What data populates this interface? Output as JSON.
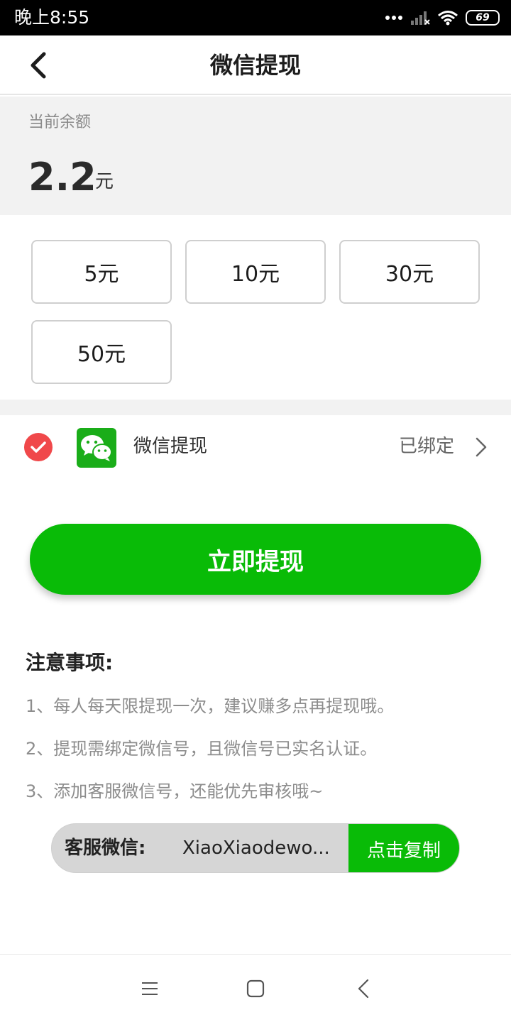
{
  "status_bar": {
    "time": "晚上8:55",
    "battery": "69",
    "icons": [
      "more-dots-icon",
      "signal-icon",
      "wifi-icon",
      "battery-icon"
    ]
  },
  "nav": {
    "title": "微信提现",
    "back_icon": "chevron-left-icon"
  },
  "balance": {
    "label": "当前余额",
    "value": "2.2",
    "unit": "元"
  },
  "amount_options": [
    {
      "label": "5元"
    },
    {
      "label": "10元"
    },
    {
      "label": "30元"
    },
    {
      "label": "50元"
    }
  ],
  "payment_method": {
    "label": "微信提现",
    "status": "已绑定",
    "selected_icon": "check-circle-icon",
    "logo_icon": "wechat-icon",
    "arrow_icon": "chevron-right-icon"
  },
  "withdraw_button": {
    "label": "立即提现"
  },
  "notes": {
    "title": "注意事项:",
    "items": [
      "1、每人每天限提现一次，建议赚多点再提现哦。",
      "2、提现需绑定微信号，且微信号已实名认证。",
      "3、添加客服微信号，还能优先审核哦~"
    ]
  },
  "customer_service": {
    "label": "客服微信:",
    "wechat_id": "XiaoXiaodewo...",
    "copy_label": "点击复制"
  },
  "system_nav": {
    "icons": [
      "menu-icon",
      "home-icon",
      "back-icon"
    ]
  },
  "colors": {
    "accent_green": "#09bb07",
    "check_red": "#f0484a",
    "panel_gray": "#f2f2f2"
  }
}
